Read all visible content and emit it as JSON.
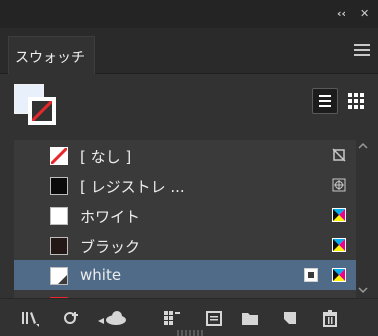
{
  "panel": {
    "tab_label": "スウォッチ"
  },
  "titlebar": {
    "collapse_glyph": "‹‹",
    "close_glyph": "✕"
  },
  "swatches": [
    {
      "label": "[ なし ]",
      "color": "none"
    },
    {
      "label": "[ レジストレ ...",
      "color": "#0a0a0a"
    },
    {
      "label": "ホワイト",
      "color": "#ffffff"
    },
    {
      "label": "ブラック",
      "color": "#231815"
    },
    {
      "label": "white",
      "color": "#ffffff",
      "selected": true
    }
  ],
  "colors": {
    "panel_bg": "#323232",
    "title_bg": "#242424",
    "list_bg": "#3a3a3a",
    "selected_row": "#506b88",
    "none_slash": "#e8262b",
    "partial_swatch": "#e8262b"
  }
}
